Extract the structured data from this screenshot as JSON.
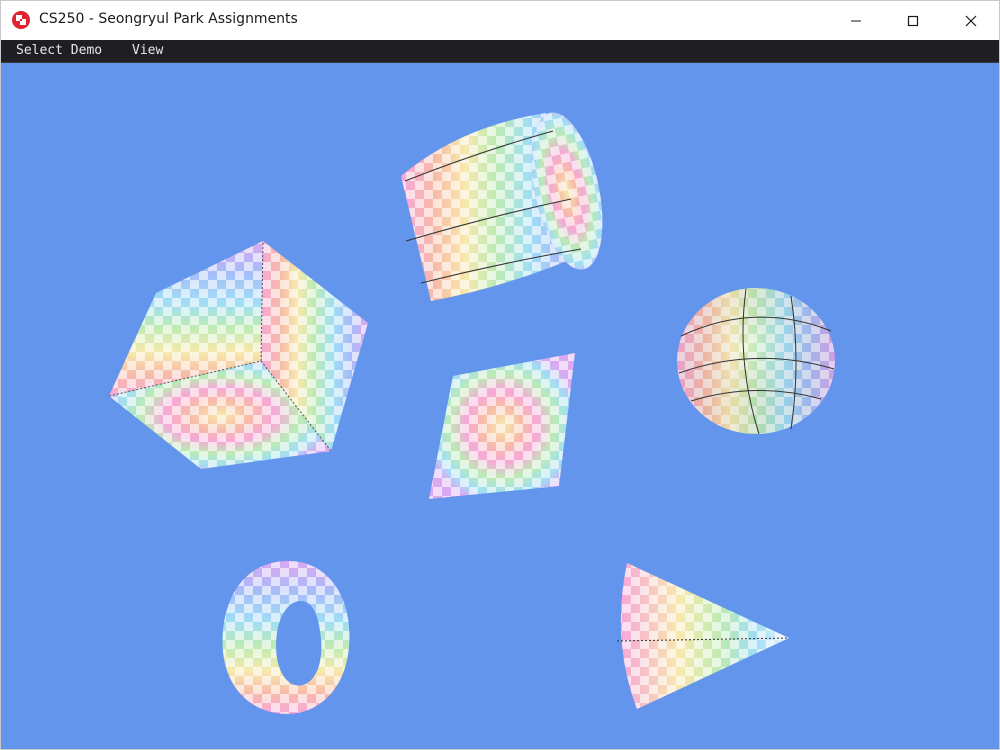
{
  "window": {
    "title": "CS250 - Seongryul Park Assignments",
    "icon": "app-logo-icon",
    "controls": [
      "minimize-icon",
      "maximize-icon",
      "close-icon"
    ]
  },
  "menubar": {
    "items": [
      {
        "label": "Select Demo"
      },
      {
        "label": "View"
      }
    ]
  },
  "scene": {
    "background_color": "#6495ed",
    "objects": [
      "cube",
      "cylinder",
      "sphere",
      "plane",
      "torus",
      "cone"
    ]
  },
  "colors": {
    "menubar": "#1f1f23",
    "titlebar": "#ffffff",
    "viewport": "#6495ed"
  }
}
